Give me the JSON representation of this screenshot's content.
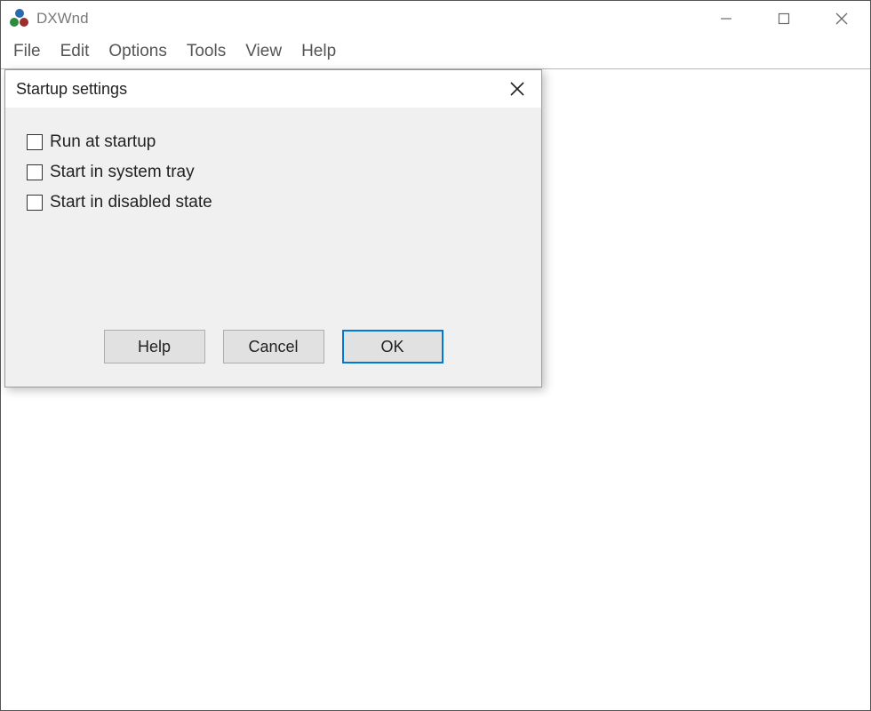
{
  "window": {
    "title": "DXWnd"
  },
  "menubar": {
    "items": [
      "File",
      "Edit",
      "Options",
      "Tools",
      "View",
      "Help"
    ]
  },
  "dialog": {
    "title": "Startup settings",
    "checkboxes": [
      {
        "label": "Run at startup",
        "checked": false
      },
      {
        "label": "Start in system tray",
        "checked": false
      },
      {
        "label": "Start in disabled state",
        "checked": false
      }
    ],
    "buttons": {
      "help": "Help",
      "cancel": "Cancel",
      "ok": "OK"
    }
  }
}
